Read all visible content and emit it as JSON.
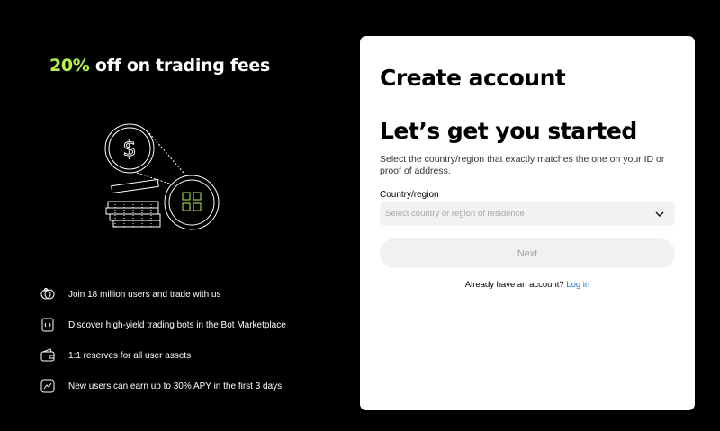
{
  "promo": {
    "highlight": "20%",
    "text": " off on trading fees"
  },
  "features": [
    {
      "icon": "users-icon",
      "text": "Join 18 million users and trade with us"
    },
    {
      "icon": "bot-icon",
      "text": "Discover high-yield trading bots in the Bot Marketplace"
    },
    {
      "icon": "wallet-icon",
      "text": "1:1 reserves for all user assets"
    },
    {
      "icon": "chart-icon",
      "text": "New users can earn up to 30% APY in the first 3 days"
    }
  ],
  "card": {
    "title": "Create account",
    "subtitle": "Let’s get you started",
    "description": "Select the country/region that exactly matches the one on your ID or proof of address.",
    "country_label": "Country/region",
    "country_placeholder": "Select country or region of residence",
    "next_label": "Next",
    "login_prompt": "Already have an account?",
    "login_link": "Log in"
  },
  "colors": {
    "accent": "#b7f24a",
    "link": "#1a73e8",
    "background": "#000000",
    "card": "#ffffff"
  }
}
